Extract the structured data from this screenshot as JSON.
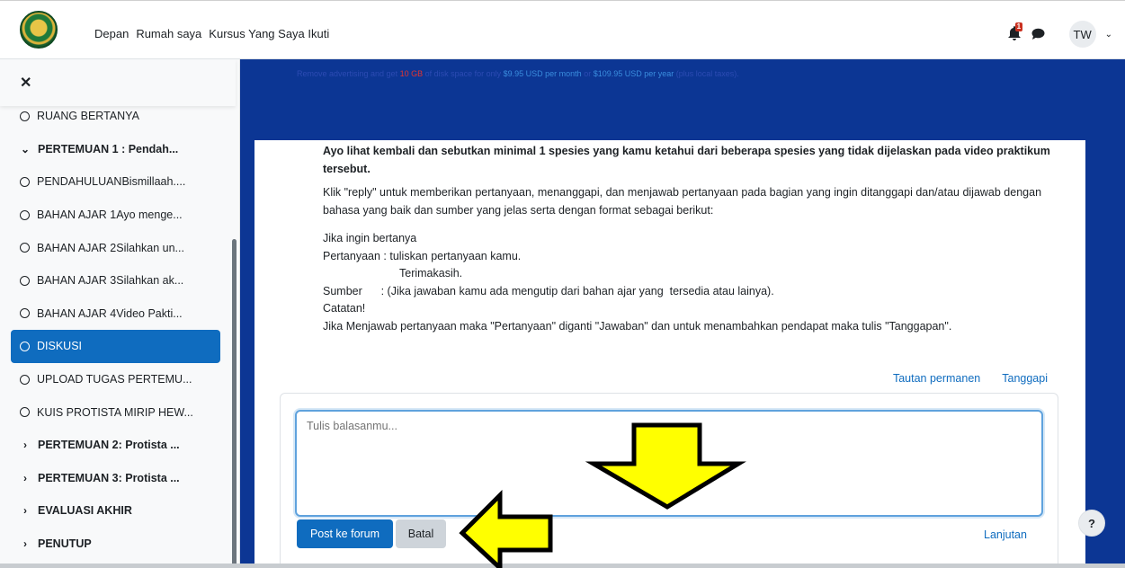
{
  "navbar": {
    "links": [
      "Depan",
      "Rumah saya",
      "Kursus Yang Saya Ikuti"
    ],
    "notification_count": "1",
    "user_initials": "TW"
  },
  "drawer": {
    "items": [
      {
        "label": "RUANG BERTANYA",
        "kind": "activity"
      },
      {
        "label": "PERTEMUAN 1 : Pendah...",
        "kind": "section-open"
      },
      {
        "label": "PENDAHULUANBismillaah....",
        "kind": "activity"
      },
      {
        "label": "BAHAN AJAR 1Ayo menge...",
        "kind": "activity"
      },
      {
        "label": "BAHAN AJAR 2Silahkan un...",
        "kind": "activity"
      },
      {
        "label": "BAHAN AJAR 3Silahkan ak...",
        "kind": "activity"
      },
      {
        "label": "BAHAN AJAR 4Video Pakti...",
        "kind": "activity"
      },
      {
        "label": "DISKUSI",
        "kind": "activity-active"
      },
      {
        "label": "UPLOAD TUGAS PERTEMU...",
        "kind": "activity"
      },
      {
        "label": "KUIS PROTISTA MIRIP HEW...",
        "kind": "activity"
      },
      {
        "label": "PERTEMUAN 2: Protista ...",
        "kind": "section-closed"
      },
      {
        "label": "PERTEMUAN 3: Protista ...",
        "kind": "section-closed"
      },
      {
        "label": "EVALUASI AKHIR",
        "kind": "section-closed"
      },
      {
        "label": "PENUTUP",
        "kind": "section-closed"
      }
    ]
  },
  "ad": {
    "part1": "Remove advertising and get ",
    "highlight": "10 GB",
    "part2": " of disk space for only ",
    "price_month": "$9.95 USD per month",
    "part3": " or ",
    "price_year": "$109.95 USD per year",
    "part4": " (plus local taxes)."
  },
  "post": {
    "heading": "Ayo lihat kembali dan sebutkan minimal 1 spesies yang kamu ketahui dari beberapa spesies yang tidak dijelaskan pada video praktikum tersebut.",
    "instruction": "Klik \"reply\" untuk memberikan pertanyaan, menanggapi, dan menjawab pertanyaan pada bagian yang ingin ditanggapi dan/atau dijawab dengan bahasa yang baik dan sumber yang jelas serta dengan format sebagai berikut:",
    "line1": "Jika ingin bertanya",
    "line2": "Pertanyaan : tuliskan pertanyaan kamu.",
    "line3": "Terimakasih.",
    "line4": "Sumber      : (Jika jawaban kamu ada mengutip dari bahan ajar yang  tersedia atau lainya).",
    "line5": "Catatan!",
    "line6": "Jika Menjawab pertanyaan maka \"Pertanyaan\" diganti \"Jawaban\" dan untuk menambahkan pendapat maka tulis \"Tanggapan\"."
  },
  "actions": {
    "permalink": "Tautan permanen",
    "reply": "Tanggapi"
  },
  "reply_form": {
    "placeholder": "Tulis balasanmu...",
    "post_button": "Post ke forum",
    "cancel_button": "Batal",
    "advanced_link": "Lanjutan"
  },
  "help": {
    "label": "?"
  },
  "annotation": {
    "arrow_color": "#ffff00"
  }
}
